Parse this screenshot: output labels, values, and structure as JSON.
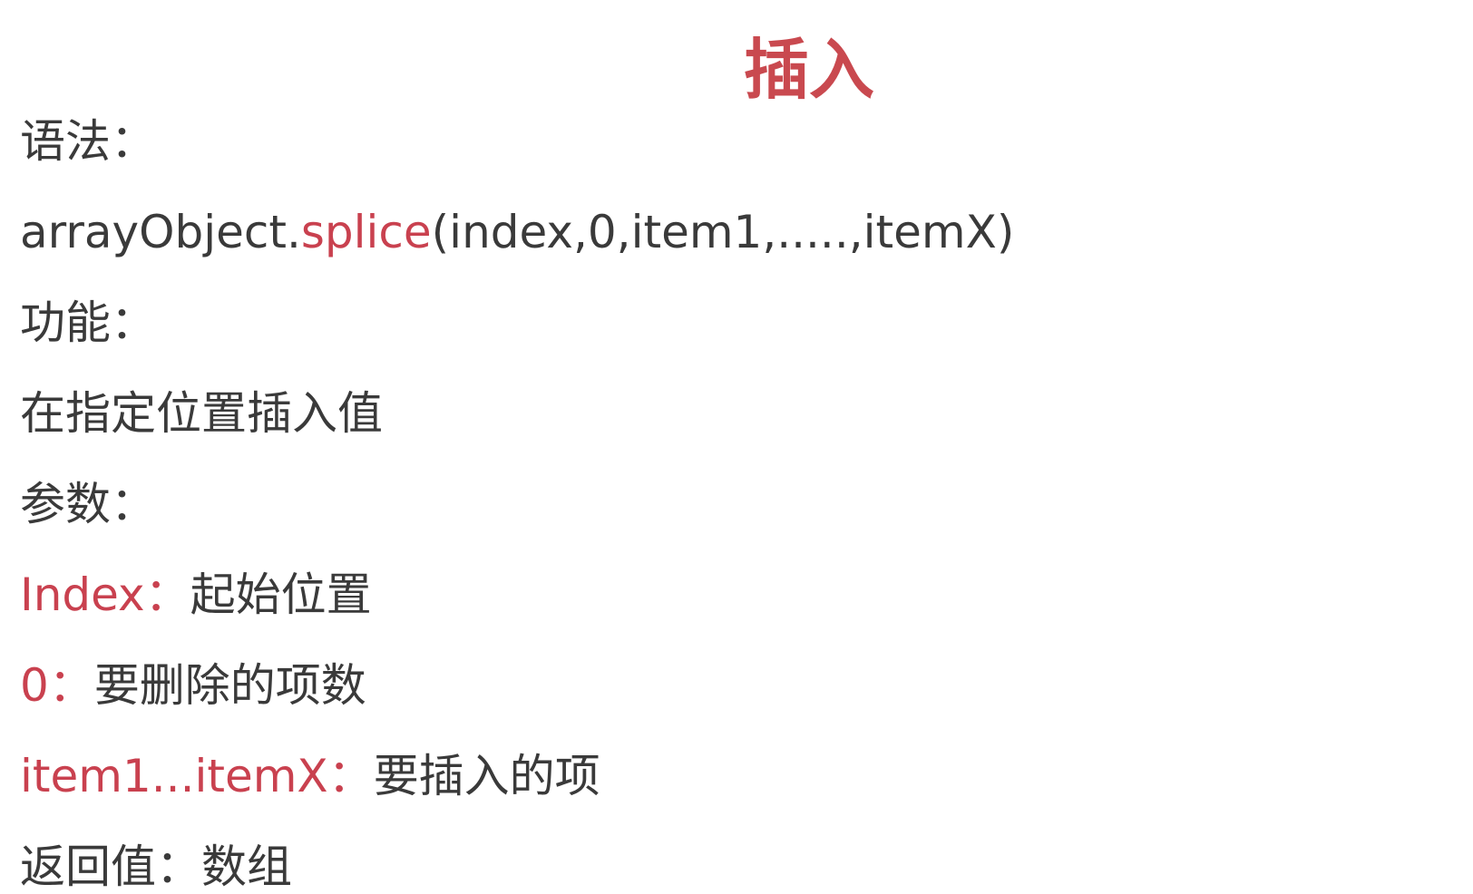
{
  "title": "插入",
  "syntax": {
    "label": "语法：",
    "code_prefix": "arrayObject.",
    "code_method": "splice",
    "code_args": "(index,0,item1,.....,itemX)"
  },
  "function": {
    "label": "功能：",
    "description": "在指定位置插入值"
  },
  "params": {
    "label": "参数：",
    "items": [
      {
        "name": "Index：",
        "desc": "起始位置"
      },
      {
        "name": "0：",
        "desc": "要删除的项数"
      },
      {
        "name": "item1...itemX：",
        "desc": "要插入的项"
      }
    ]
  },
  "return_value": {
    "text": "返回值：数组"
  },
  "colors": {
    "accent": "#c9414f",
    "text": "#3a3a3a",
    "background": "#ffffff"
  }
}
